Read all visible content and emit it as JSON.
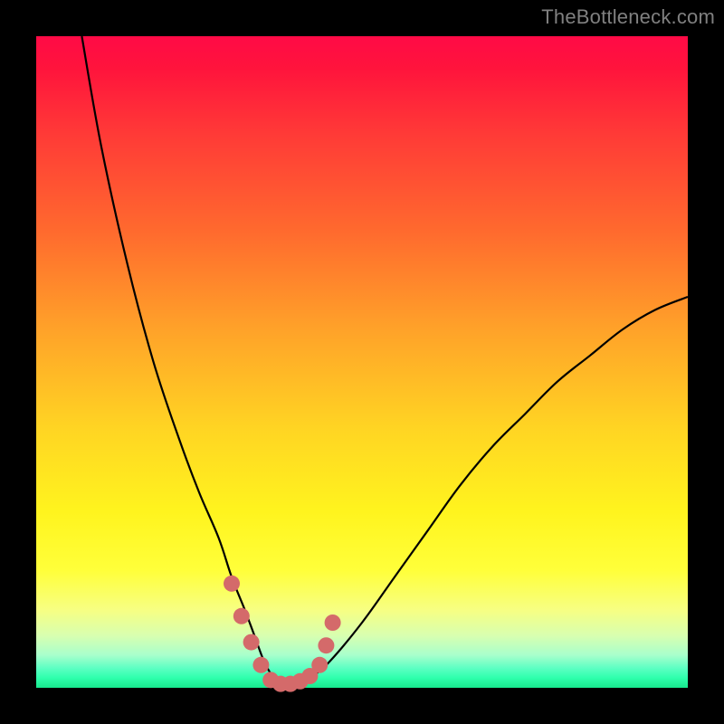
{
  "watermark": "TheBottleneck.com",
  "chart_data": {
    "type": "line",
    "title": "",
    "xlabel": "",
    "ylabel": "",
    "xlim": [
      0,
      100
    ],
    "ylim": [
      0,
      100
    ],
    "background_gradient_stops": [
      {
        "pos": 0,
        "color": "#ff0a46"
      },
      {
        "pos": 5,
        "color": "#ff143c"
      },
      {
        "pos": 15,
        "color": "#ff3a37"
      },
      {
        "pos": 30,
        "color": "#ff6a2e"
      },
      {
        "pos": 45,
        "color": "#ffa229"
      },
      {
        "pos": 60,
        "color": "#ffd423"
      },
      {
        "pos": 73,
        "color": "#fff41e"
      },
      {
        "pos": 82,
        "color": "#ffff3a"
      },
      {
        "pos": 88,
        "color": "#f7ff82"
      },
      {
        "pos": 92,
        "color": "#d8ffb0"
      },
      {
        "pos": 95,
        "color": "#a8ffcc"
      },
      {
        "pos": 97,
        "color": "#5cffc3"
      },
      {
        "pos": 98.5,
        "color": "#2effac"
      },
      {
        "pos": 100,
        "color": "#18e88e"
      }
    ],
    "series": [
      {
        "name": "curve",
        "color": "#000000",
        "x": [
          7,
          10,
          14,
          18,
          22,
          25,
          28,
          30,
          32,
          33.5,
          35,
          36.5,
          38,
          40,
          42,
          45,
          50,
          55,
          60,
          65,
          70,
          75,
          80,
          85,
          90,
          95,
          100
        ],
        "y": [
          100,
          83,
          65,
          50,
          38,
          30,
          23,
          17,
          12,
          8,
          4,
          1.5,
          0.5,
          0.5,
          1.5,
          4,
          10,
          17,
          24,
          31,
          37,
          42,
          47,
          51,
          55,
          58,
          60
        ]
      }
    ],
    "markers": {
      "name": "highlight-dots",
      "color": "#d46a6a",
      "radius_px": 9,
      "x": [
        30,
        31.5,
        33,
        34.5,
        36,
        37.5,
        39,
        40.5,
        42,
        43.5,
        44.5,
        45.5
      ],
      "y": [
        16,
        11,
        7,
        3.5,
        1.2,
        0.6,
        0.6,
        1.0,
        1.8,
        3.5,
        6.5,
        10
      ]
    }
  }
}
